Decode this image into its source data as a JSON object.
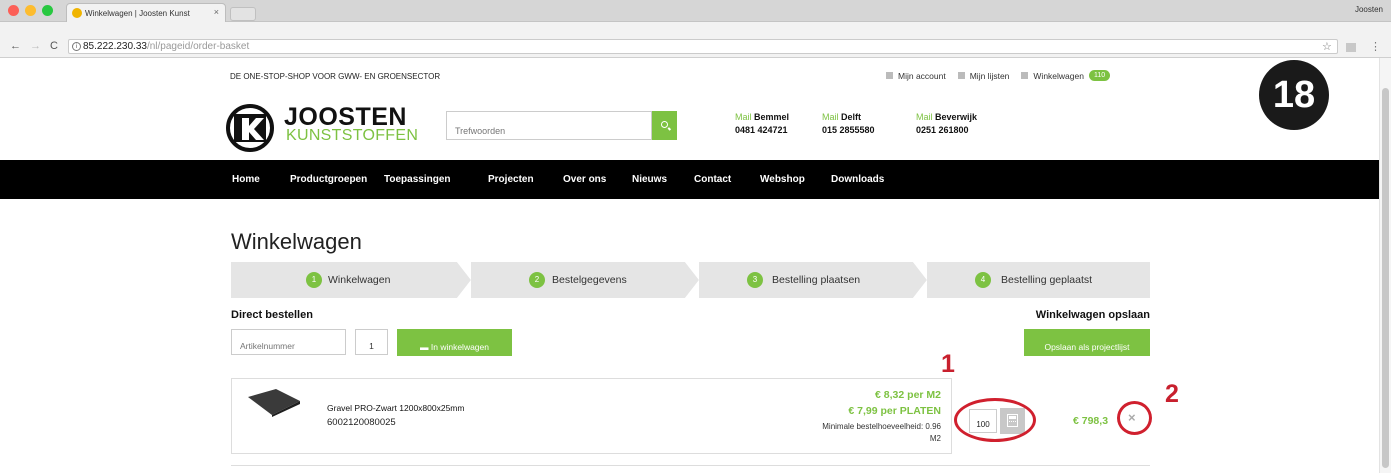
{
  "browser": {
    "tab_title": "Winkelwagen | Joosten Kunst",
    "tab_close": "×",
    "profile": "Joosten",
    "url_host": "85.222.230.33",
    "url_path": "/nl/pageid/order-basket",
    "icons": [
      "back-icon",
      "forward-icon",
      "reload-icon",
      "info-icon",
      "star-icon",
      "extension-icon",
      "menu-icon"
    ]
  },
  "site": {
    "tagline": "DE ONE-STOP-SHOP VOOR GWW- EN GROENSECTOR",
    "top_links": {
      "account": "Mijn account",
      "lists": "Mijn lijsten",
      "cart": "Winkelwagen",
      "cart_count": "110"
    },
    "logo": {
      "name": "JOOSTEN",
      "sub": "KUNSTSTOFFEN",
      "mark": "K"
    },
    "search": {
      "placeholder": "Trefwoorden"
    },
    "branches": [
      {
        "mail": "Mail",
        "city": "Bemmel",
        "phone": "0481 424721"
      },
      {
        "mail": "Mail",
        "city": "Delft",
        "phone": "015 2855580"
      },
      {
        "mail": "Mail",
        "city": "Beverwijk",
        "phone": "0251 261800"
      }
    ],
    "nav": [
      "Home",
      "Productgroepen",
      "Toepassingen",
      "Projecten",
      "Over ons",
      "Nieuws",
      "Contact",
      "Webshop",
      "Downloads"
    ]
  },
  "page": {
    "title": "Winkelwagen",
    "steps": [
      {
        "num": "1",
        "label": "Winkelwagen"
      },
      {
        "num": "2",
        "label": "Bestelgegevens"
      },
      {
        "num": "3",
        "label": "Bestelling plaatsen"
      },
      {
        "num": "4",
        "label": "Bestelling geplaatst"
      }
    ],
    "active_step": 1,
    "direct_order": {
      "title": "Direct bestellen",
      "article_placeholder": "Artikelnummer",
      "qty_value": "1",
      "add_button": "In winkelwagen"
    },
    "save_cart": {
      "title": "Winkelwagen opslaan",
      "button": "Opslaan als projectlijst"
    },
    "item": {
      "name": "Gravel PRO-Zwart 1200x800x25mm",
      "sku": "6002120080025",
      "price_m2": "€ 8,32 per M2",
      "price_plate": "€ 7,99 per PLATEN",
      "min_order_line1": "Minimale bestelhoeveelheid: 0.96",
      "min_order_line2": "M2",
      "quantity": "100",
      "line_total": "€ 798,3",
      "remove": "×"
    }
  },
  "annotations": {
    "step_number": "18",
    "callout_1": "1",
    "callout_2": "2"
  },
  "colors": {
    "accent_green": "#7dc242",
    "nav_black": "#000000",
    "annotation_red": "#d0202e"
  }
}
